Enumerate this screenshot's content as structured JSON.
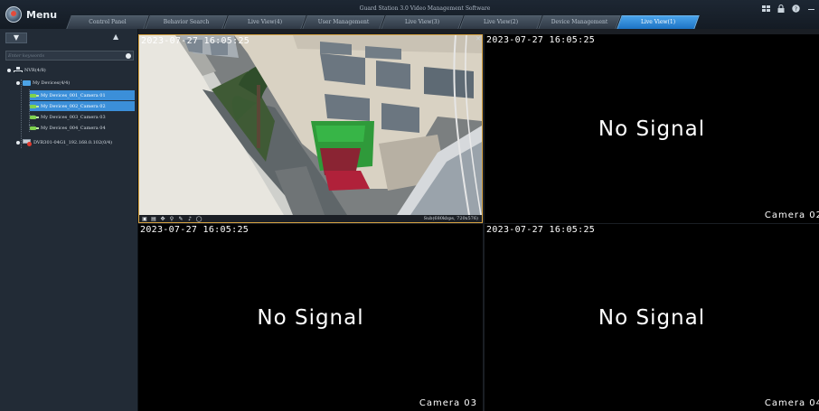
{
  "app": {
    "title": "Guard Station 3.0 Video Management Software",
    "menu_label": "Menu"
  },
  "tabs": [
    {
      "label": "Control Panel",
      "active": false
    },
    {
      "label": "Behavior Search",
      "active": false
    },
    {
      "label": "Live View(4)",
      "active": false
    },
    {
      "label": "User Management",
      "active": false
    },
    {
      "label": "Live View(3)",
      "active": false
    },
    {
      "label": "Live View(2)",
      "active": false
    },
    {
      "label": "Device Management",
      "active": false
    },
    {
      "label": "Live View(1)",
      "active": true
    }
  ],
  "window_controls": [
    "grid-icon",
    "lock-icon",
    "help-icon",
    "minimize-icon"
  ],
  "sidebar": {
    "search": {
      "placeholder": "Enter keywords",
      "value": ""
    },
    "tree": {
      "root": "NVR(4/8)",
      "group": "My Devices(4/4)",
      "cameras": [
        {
          "label": "My Devices_001_Camera 01",
          "selected": true
        },
        {
          "label": "My Devices_002_Camera 02",
          "selected": true
        },
        {
          "label": "My Devices_003_Camera 03",
          "selected": false
        },
        {
          "label": "My Devices_004_Camera 04",
          "selected": false
        }
      ],
      "device": "DVR301-04G1_192.168.0.102(0/4)"
    }
  },
  "grid": {
    "tiles": [
      {
        "timestamp": "2023-07-27 16:05:25",
        "status": "live",
        "stream_info": "Sub(680kbps, 720x576)"
      },
      {
        "timestamp": "2023-07-27 16:05:25",
        "status": "No Signal",
        "camera": "Camera 02"
      },
      {
        "timestamp": "2023-07-27 16:05:25",
        "status": "No Signal",
        "camera": "Camera 03"
      },
      {
        "timestamp": "2023-07-27 16:05:25",
        "status": "No Signal",
        "camera": "Camera 04"
      }
    ]
  },
  "colors": {
    "accent_tab": "#2f8be0",
    "selection": "#3b8fd9",
    "active_tile_border": "#d9a441"
  }
}
